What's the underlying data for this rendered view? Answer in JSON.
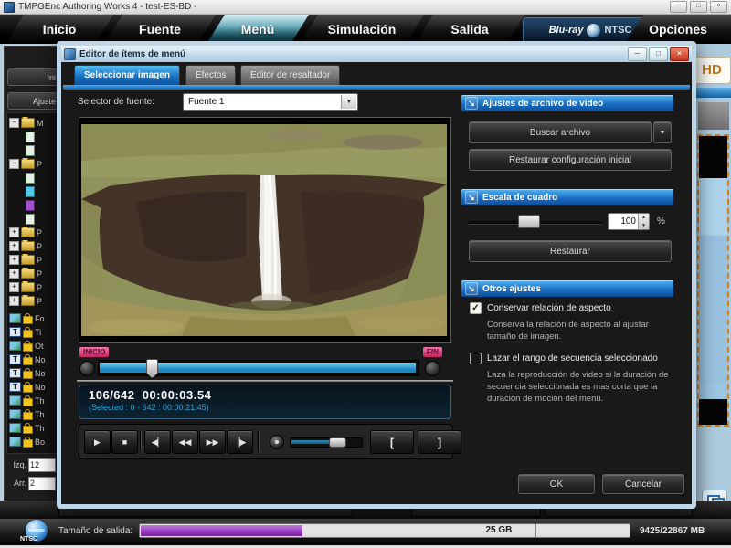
{
  "icons": {
    "minimize": "─",
    "maximize": "□",
    "close": "×",
    "section_arrow": "↘",
    "dropdown": "▼",
    "spin_up": "▲",
    "spin_down": "▼",
    "check": "✓",
    "plus": "+",
    "minus": "−",
    "t": "T",
    "play": "▶",
    "stop": "■",
    "step_back": "◀▏",
    "rewind": "◀◀",
    "forward": "▶▶",
    "step_forward": "▕▶",
    "bracket_open": "[",
    "bracket_close": "]"
  },
  "window": {
    "title": "TMPGEnc Authoring Works 4 - test-ES-BD -"
  },
  "ribbon": {
    "tabs": [
      "Inicio",
      "Fuente",
      "Menú",
      "Simulación",
      "Salida"
    ],
    "options": "Opciones",
    "logo_main": "Blu-ray",
    "logo_sub": "NTSC"
  },
  "sidebar": {
    "top_buttons": [
      "Ini",
      "Ajuste"
    ],
    "tree_folders": [
      "M",
      "P",
      "P",
      "P",
      "P",
      "P",
      "P",
      "P"
    ],
    "locks": [
      "Fo",
      "Ti",
      "Ot",
      "No",
      "No",
      "No",
      "Th",
      "Th",
      "Th",
      "Bo"
    ],
    "izq_label": "Izq.",
    "izq_value": "12",
    "arr_label": "Arr.",
    "arr_value": "2"
  },
  "right_panel": {
    "hd_badge": "HD"
  },
  "dialog": {
    "title": "Editor de ítems de menú",
    "tabs": [
      "Seleccionar imagen",
      "Efectos",
      "Editor de resaltador"
    ],
    "source_label": "Selector de fuente:",
    "source_value": "Fuente 1",
    "timeline": {
      "start": "INICIO",
      "end": "FIN"
    },
    "counter_line1": "106/642  00:00:03.54",
    "counter_line2": "(Selected : 0 - 642 : 00:00:21.45)",
    "video_section": {
      "title": "Ajustes de archivo de video",
      "browse": "Buscar archivo",
      "restore_initial": "Restaurar configuración inicial"
    },
    "scale_section": {
      "title": "Escala de cuadro",
      "value": "100",
      "unit": "%",
      "restore": "Restaurar"
    },
    "other_section": {
      "title": "Otros ajustes",
      "cb1_label": "Conservar relación de aspecto",
      "cb1_desc": "Conserva la relación de aspecto al ajustar tamaño de imagen.",
      "cb2_label": "Lazar el rango de secuencia seleccionado",
      "cb2_desc": "Laza la reproducción de video si la duración de secuencia seleccionada es mas corta que la duración de moción del menú."
    },
    "ok": "OK",
    "cancel": "Cancelar"
  },
  "statusbar": {
    "label": "Tamaño de salida:",
    "gb_marker": "25 GB",
    "mb_text": "9425/22867 MB",
    "ntsc": "NTSC"
  }
}
